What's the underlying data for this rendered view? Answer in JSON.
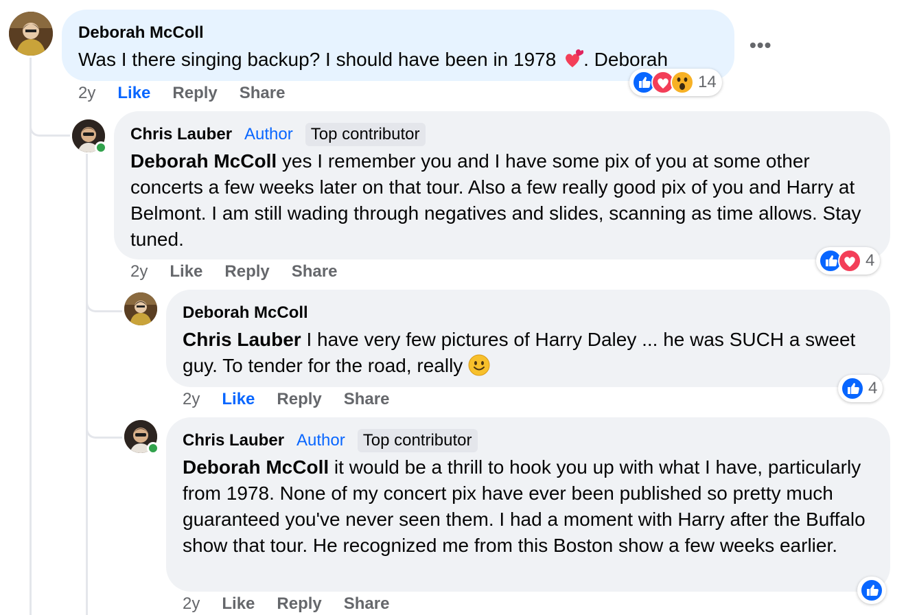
{
  "comments": [
    {
      "author": "Deborah McColl",
      "text": "Was I there singing backup? I should have been in 1978 ",
      "text_suffix": ". Deborah",
      "inline_emoji": "two-hearts-icon",
      "actions": {
        "time": "2y",
        "like": "Like",
        "reply": "Reply",
        "share": "Share"
      },
      "reactions": {
        "icons": [
          "like",
          "love",
          "wow"
        ],
        "count": "14"
      }
    },
    {
      "author": "Chris Lauber",
      "badges": [
        "Author",
        "Top contributor"
      ],
      "mention": "Deborah McColl",
      "text": " yes I remember you and I have some pix of you at some other concerts a few weeks later on that tour. Also a few really good pix of you and Harry at Belmont. I am still wading through negatives and slides, scanning as time allows. Stay tuned.",
      "actions": {
        "time": "2y",
        "like": "Like",
        "reply": "Reply",
        "share": "Share"
      },
      "reactions": {
        "icons": [
          "like",
          "love"
        ],
        "count": "4"
      }
    },
    {
      "author": "Deborah McColl",
      "mention": "Chris Lauber",
      "text": " I have very few pictures of Harry Daley ... he was SUCH a sweet guy. To tender for the road, really ",
      "inline_emoji": "smiley-icon",
      "actions": {
        "time": "2y",
        "like": "Like",
        "reply": "Reply",
        "share": "Share"
      },
      "reactions": {
        "icons": [
          "like"
        ],
        "count": "4"
      }
    },
    {
      "author": "Chris Lauber",
      "badges": [
        "Author",
        "Top contributor"
      ],
      "mention": "Deborah McColl",
      "text": " it would be a thrill to hook you up with what I have, particularly from 1978. None of my concert pix have ever been published so pretty much guaranteed you've never seen them. I had a moment with Harry after the Buffalo show that tour. He recognized me from this Boston show a few weeks earlier.",
      "actions": {
        "time": "2y",
        "like": "Like",
        "reply": "Reply",
        "share": "Share"
      },
      "reactions": {
        "icons": [
          "like"
        ],
        "count": ""
      }
    }
  ],
  "more_options": "•••",
  "colors": {
    "bubble": "#f0f2f5",
    "bubble_active": "#e7f3ff",
    "accent": "#0866ff",
    "love": "#f33e58",
    "online": "#31a24c"
  }
}
